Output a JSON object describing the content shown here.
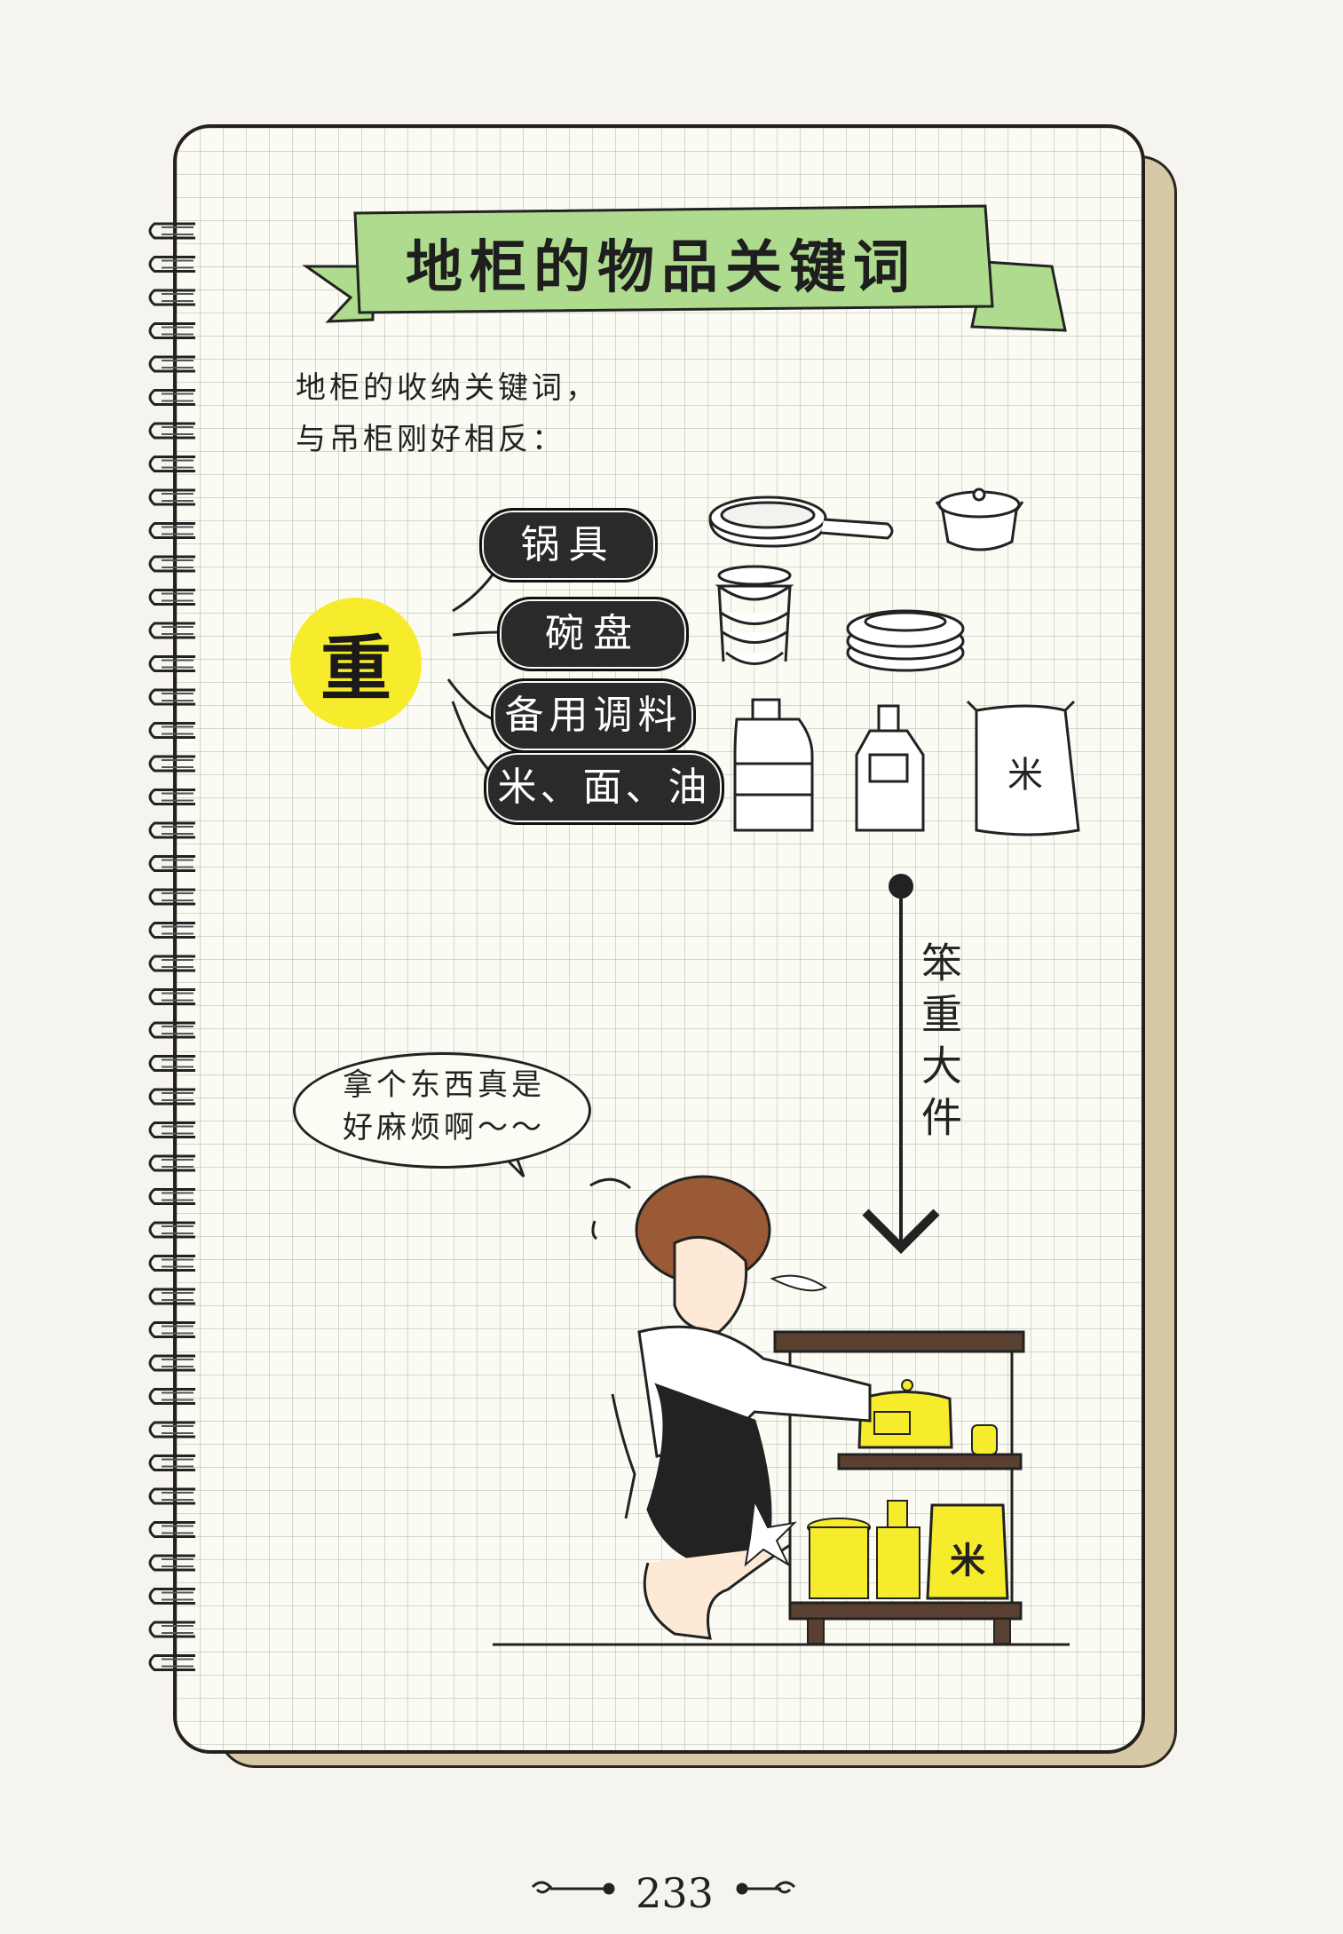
{
  "title": "地柜的物品关键词",
  "intro": {
    "line1": "地柜的收纳关键词，",
    "line2": "与吊柜刚好相反："
  },
  "heavy_label": "重",
  "categories": [
    {
      "label": "锅具"
    },
    {
      "label": "碗盘"
    },
    {
      "label": "备用调料"
    },
    {
      "label": "米、面、油"
    }
  ],
  "rice_bag_text": "米",
  "vertical_caption": "笨重大件",
  "speech": {
    "line1": "拿个东西真是",
    "line2": "好麻烦啊～～"
  },
  "cabinet_rice_text": "米",
  "page_number": "233",
  "colors": {
    "banner_green": "#aedb8e",
    "highlight_yellow": "#f7ec2c",
    "tag_black": "#2a2a2a",
    "hair_brown": "#9a5a36",
    "cabinet_brown": "#5a4030"
  }
}
